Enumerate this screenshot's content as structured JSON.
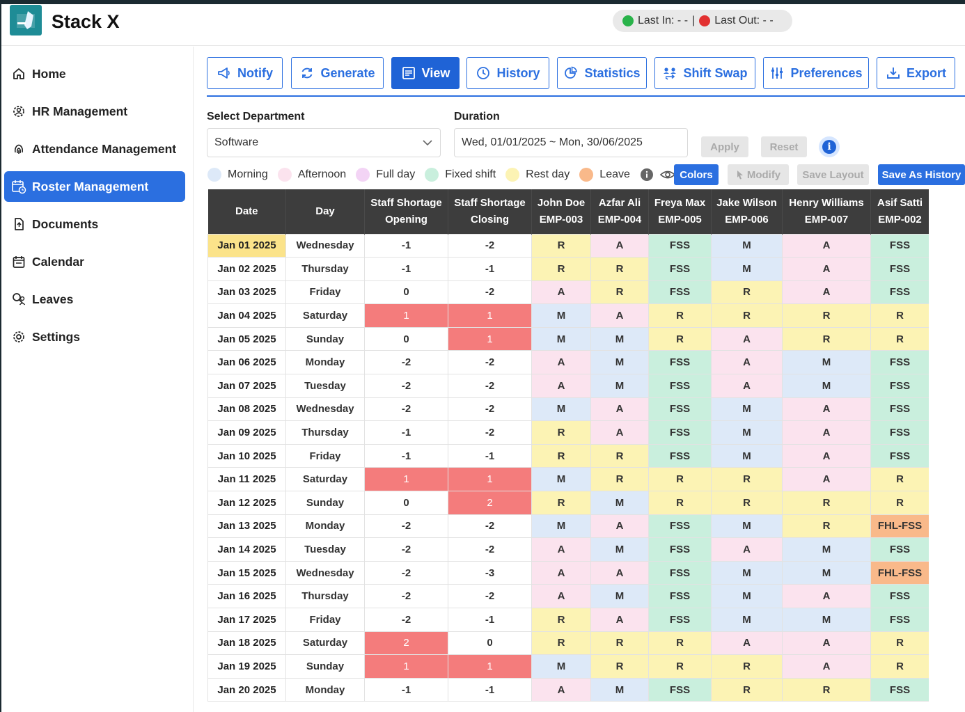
{
  "app": {
    "title": "Stack X",
    "logo_text": "Stack X"
  },
  "status": {
    "last_in": "Last In: - -",
    "separator": "|",
    "last_out": "Last Out: - -"
  },
  "sidebar": {
    "items": [
      {
        "label": "Home",
        "icon": "home-icon"
      },
      {
        "label": "HR Management",
        "icon": "users-gear-icon"
      },
      {
        "label": "Attendance Management",
        "icon": "fingerprint-icon"
      },
      {
        "label": "Roster Management",
        "icon": "calendar-clock-icon",
        "active": true
      },
      {
        "label": "Documents",
        "icon": "document-icon"
      },
      {
        "label": "Calendar",
        "icon": "calendar-icon"
      },
      {
        "label": "Leaves",
        "icon": "leaves-icon"
      },
      {
        "label": "Settings",
        "icon": "gear-icon"
      }
    ]
  },
  "toolbar": {
    "notify": "Notify",
    "generate": "Generate",
    "view": "View",
    "history": "History",
    "statistics": "Statistics",
    "shift_swap": "Shift Swap",
    "preferences": "Preferences",
    "export": "Export"
  },
  "filters": {
    "department_label": "Select Department",
    "department_value": "Software",
    "duration_label": "Duration",
    "duration_value": "Wed, 01/01/2025 ~ Mon, 30/06/2025",
    "apply": "Apply",
    "reset": "Reset"
  },
  "legend": [
    {
      "label": "Morning",
      "color": "#dde9f8"
    },
    {
      "label": "Afternoon",
      "color": "#fbe3ee"
    },
    {
      "label": "Full day",
      "color": "#f3d4f5"
    },
    {
      "label": "Fixed shift",
      "color": "#c9efdd"
    },
    {
      "label": "Rest day",
      "color": "#fcf3b4"
    },
    {
      "label": "Leave",
      "color": "#f9b98a"
    }
  ],
  "actions": {
    "colors": "Colors",
    "modify": "Modify",
    "save_layout": "Save Layout",
    "save_as_history": "Save As History"
  },
  "table": {
    "headers": [
      {
        "line1": "Date",
        "line2": ""
      },
      {
        "line1": "Day",
        "line2": ""
      },
      {
        "line1": "Staff Shortage",
        "line2": "Opening"
      },
      {
        "line1": "Staff Shortage",
        "line2": "Closing"
      },
      {
        "line1": "John Doe",
        "line2": "EMP-003"
      },
      {
        "line1": "Azfar Ali",
        "line2": "EMP-004"
      },
      {
        "line1": "Freya Max",
        "line2": "EMP-005"
      },
      {
        "line1": "Jake Wilson",
        "line2": "EMP-006"
      },
      {
        "line1": "Henry Williams",
        "line2": "EMP-007"
      },
      {
        "line1": "Asif Satti",
        "line2": "EMP-002"
      }
    ],
    "rows": [
      {
        "date": "Jan 01 2025",
        "day": "Wednesday",
        "open": "-1",
        "close": "-2",
        "shifts": [
          "R",
          "A",
          "FSS",
          "M",
          "A",
          "FSS"
        ],
        "highlight": true
      },
      {
        "date": "Jan 02 2025",
        "day": "Thursday",
        "open": "-1",
        "close": "-1",
        "shifts": [
          "R",
          "R",
          "FSS",
          "M",
          "A",
          "FSS"
        ]
      },
      {
        "date": "Jan 03 2025",
        "day": "Friday",
        "open": "0",
        "close": "-2",
        "shifts": [
          "A",
          "R",
          "FSS",
          "R",
          "A",
          "FSS"
        ]
      },
      {
        "date": "Jan 04 2025",
        "day": "Saturday",
        "open": "1",
        "close": "1",
        "shifts": [
          "M",
          "A",
          "R",
          "R",
          "R",
          "R"
        ]
      },
      {
        "date": "Jan 05 2025",
        "day": "Sunday",
        "open": "0",
        "close": "1",
        "shifts": [
          "M",
          "M",
          "R",
          "A",
          "R",
          "R"
        ]
      },
      {
        "date": "Jan 06 2025",
        "day": "Monday",
        "open": "-2",
        "close": "-2",
        "shifts": [
          "A",
          "M",
          "FSS",
          "A",
          "M",
          "FSS"
        ]
      },
      {
        "date": "Jan 07 2025",
        "day": "Tuesday",
        "open": "-2",
        "close": "-2",
        "shifts": [
          "A",
          "M",
          "FSS",
          "A",
          "M",
          "FSS"
        ]
      },
      {
        "date": "Jan 08 2025",
        "day": "Wednesday",
        "open": "-2",
        "close": "-2",
        "shifts": [
          "M",
          "A",
          "FSS",
          "M",
          "A",
          "FSS"
        ]
      },
      {
        "date": "Jan 09 2025",
        "day": "Thursday",
        "open": "-1",
        "close": "-2",
        "shifts": [
          "R",
          "A",
          "FSS",
          "M",
          "A",
          "FSS"
        ]
      },
      {
        "date": "Jan 10 2025",
        "day": "Friday",
        "open": "-1",
        "close": "-1",
        "shifts": [
          "R",
          "R",
          "FSS",
          "M",
          "A",
          "FSS"
        ]
      },
      {
        "date": "Jan 11 2025",
        "day": "Saturday",
        "open": "1",
        "close": "1",
        "shifts": [
          "M",
          "R",
          "R",
          "R",
          "A",
          "R"
        ]
      },
      {
        "date": "Jan 12 2025",
        "day": "Sunday",
        "open": "0",
        "close": "2",
        "shifts": [
          "R",
          "M",
          "R",
          "R",
          "R",
          "R"
        ]
      },
      {
        "date": "Jan 13 2025",
        "day": "Monday",
        "open": "-2",
        "close": "-2",
        "shifts": [
          "M",
          "A",
          "FSS",
          "M",
          "R",
          "FHL-FSS"
        ]
      },
      {
        "date": "Jan 14 2025",
        "day": "Tuesday",
        "open": "-2",
        "close": "-2",
        "shifts": [
          "A",
          "M",
          "FSS",
          "A",
          "M",
          "FSS"
        ]
      },
      {
        "date": "Jan 15 2025",
        "day": "Wednesday",
        "open": "-2",
        "close": "-3",
        "shifts": [
          "A",
          "A",
          "FSS",
          "M",
          "M",
          "FHL-FSS"
        ]
      },
      {
        "date": "Jan 16 2025",
        "day": "Thursday",
        "open": "-2",
        "close": "-2",
        "shifts": [
          "A",
          "M",
          "FSS",
          "M",
          "A",
          "FSS"
        ]
      },
      {
        "date": "Jan 17 2025",
        "day": "Friday",
        "open": "-2",
        "close": "-1",
        "shifts": [
          "R",
          "A",
          "FSS",
          "M",
          "M",
          "FSS"
        ]
      },
      {
        "date": "Jan 18 2025",
        "day": "Saturday",
        "open": "2",
        "close": "0",
        "shifts": [
          "R",
          "R",
          "R",
          "A",
          "A",
          "R"
        ]
      },
      {
        "date": "Jan 19 2025",
        "day": "Sunday",
        "open": "1",
        "close": "1",
        "shifts": [
          "M",
          "R",
          "R",
          "R",
          "A",
          "R"
        ]
      },
      {
        "date": "Jan 20 2025",
        "day": "Monday",
        "open": "-1",
        "close": "-1",
        "shifts": [
          "A",
          "M",
          "FSS",
          "R",
          "R",
          "FSS"
        ]
      }
    ]
  }
}
